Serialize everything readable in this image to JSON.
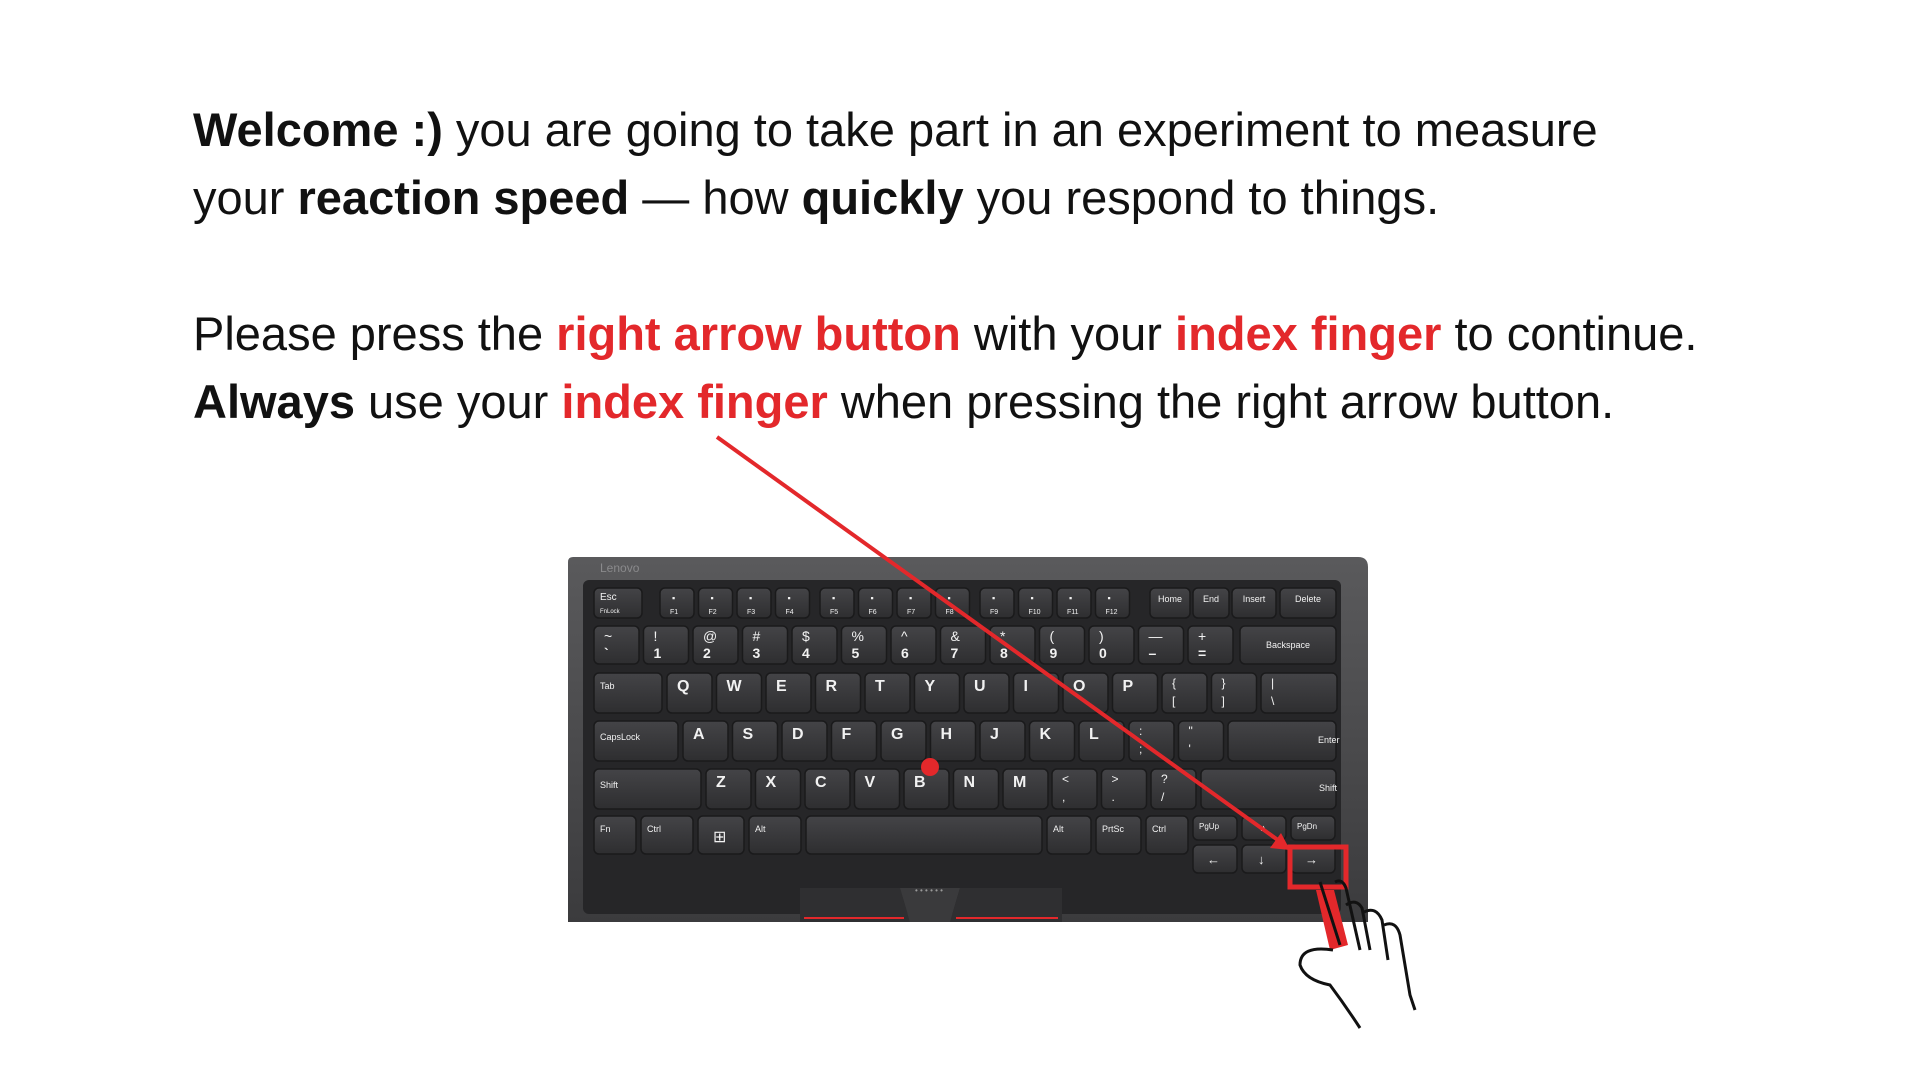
{
  "intro": {
    "welcome": "Welcome :)",
    "line1_rest": "you are going to take part in an experiment to measure",
    "line2_start": "your",
    "reaction_speed": "reaction speed",
    "dash_how": "— how",
    "quickly": "quickly",
    "line2_end": "you respond to things."
  },
  "instruction": {
    "please_press": "Please press the",
    "right_arrow_button": "right arrow button",
    "with_your": "with your",
    "index_finger": "index finger",
    "to_continue": "to continue.",
    "always": "Always",
    "use_your": "use your",
    "index_finger_2": "index finger",
    "when_pressing": "when pressing the right arrow button."
  },
  "keyboard": {
    "brand": "Lenovo",
    "fn_row": [
      "Esc",
      "",
      "",
      "",
      "",
      "",
      "",
      "",
      "",
      "",
      "",
      "",
      "",
      "Home",
      "End",
      "Insert",
      "Delete"
    ],
    "fn_sub": [
      "FnLock",
      "F1",
      "F2",
      "F3",
      "F4",
      "F5",
      "F6",
      "F7",
      "F8",
      "F9",
      "F10",
      "F11",
      "F12"
    ],
    "num_top": [
      "~",
      "!",
      "@",
      "#",
      "$",
      "%",
      "^",
      "&",
      "*",
      "(",
      ")",
      "—",
      "+"
    ],
    "num_bot": [
      "`",
      "1",
      "2",
      "3",
      "4",
      "5",
      "6",
      "7",
      "8",
      "9",
      "0",
      "–",
      "="
    ],
    "backspace": "Backspace",
    "tab": "Tab",
    "row_q": [
      "Q",
      "W",
      "E",
      "R",
      "T",
      "Y",
      "U",
      "I",
      "O",
      "P"
    ],
    "row_q_sym_top": [
      "{",
      "}",
      "|"
    ],
    "row_q_sym_bot": [
      "[",
      "]",
      "\\"
    ],
    "capslock": "CapsLock",
    "row_a": [
      "A",
      "S",
      "D",
      "F",
      "G",
      "H",
      "J",
      "K",
      "L"
    ],
    "row_a_sym_top": [
      ":",
      "\""
    ],
    "row_a_sym_bot": [
      ";",
      "'"
    ],
    "enter": "Enter",
    "shift_left": "Shift",
    "row_z": [
      "Z",
      "X",
      "C",
      "V",
      "B",
      "N",
      "M"
    ],
    "row_z_sym_top": [
      "<",
      ">",
      "?"
    ],
    "row_z_sym_bot": [
      ",",
      ".",
      "/"
    ],
    "shift_right": "Shift",
    "bottom_row": [
      "Fn",
      "Ctrl",
      "",
      "Alt",
      "",
      "Alt",
      "PrtSc",
      "Ctrl"
    ],
    "pgup": "PgUp",
    "pgdn": "PgDn",
    "arrow_left": "←",
    "arrow_down": "↓",
    "arrow_right": "→"
  },
  "colors": {
    "accent_red": "#e3282b",
    "keyboard_body": "#4a4a4b",
    "key_face": "#3a3a3c"
  }
}
